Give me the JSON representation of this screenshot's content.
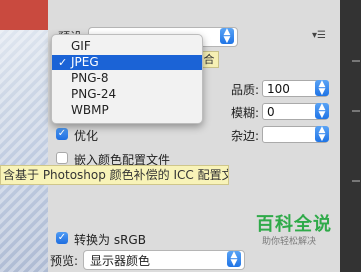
{
  "format": {
    "label": "预设",
    "selected": "JPEG",
    "options": [
      "GIF",
      "JPEG",
      "PNG-8",
      "PNG-24",
      "WBMP"
    ],
    "selected_index": 1,
    "tag": "合"
  },
  "quality": {
    "label": "品质:",
    "value": "100"
  },
  "blur": {
    "label": "模糊:",
    "value": "0"
  },
  "matte": {
    "label": "杂边:",
    "value": ""
  },
  "optimize": {
    "label": "优化",
    "checked": true
  },
  "embed_profile": {
    "label": "嵌入颜色配置文件",
    "checked": false
  },
  "tooltip": "含基于 Photoshop 颜色补偿的 ICC 配置文件",
  "convert_srgb": {
    "label": "转换为 sRGB",
    "checked": true
  },
  "preview": {
    "label": "预览:",
    "value": "显示器颜色"
  },
  "watermark": {
    "title": "百科全说",
    "subtitle": "助你轻松解决"
  },
  "colors": {
    "accent": "#1b63d6",
    "tooltip_bg": "#f8f3b8",
    "watermark": "#2faa49"
  }
}
